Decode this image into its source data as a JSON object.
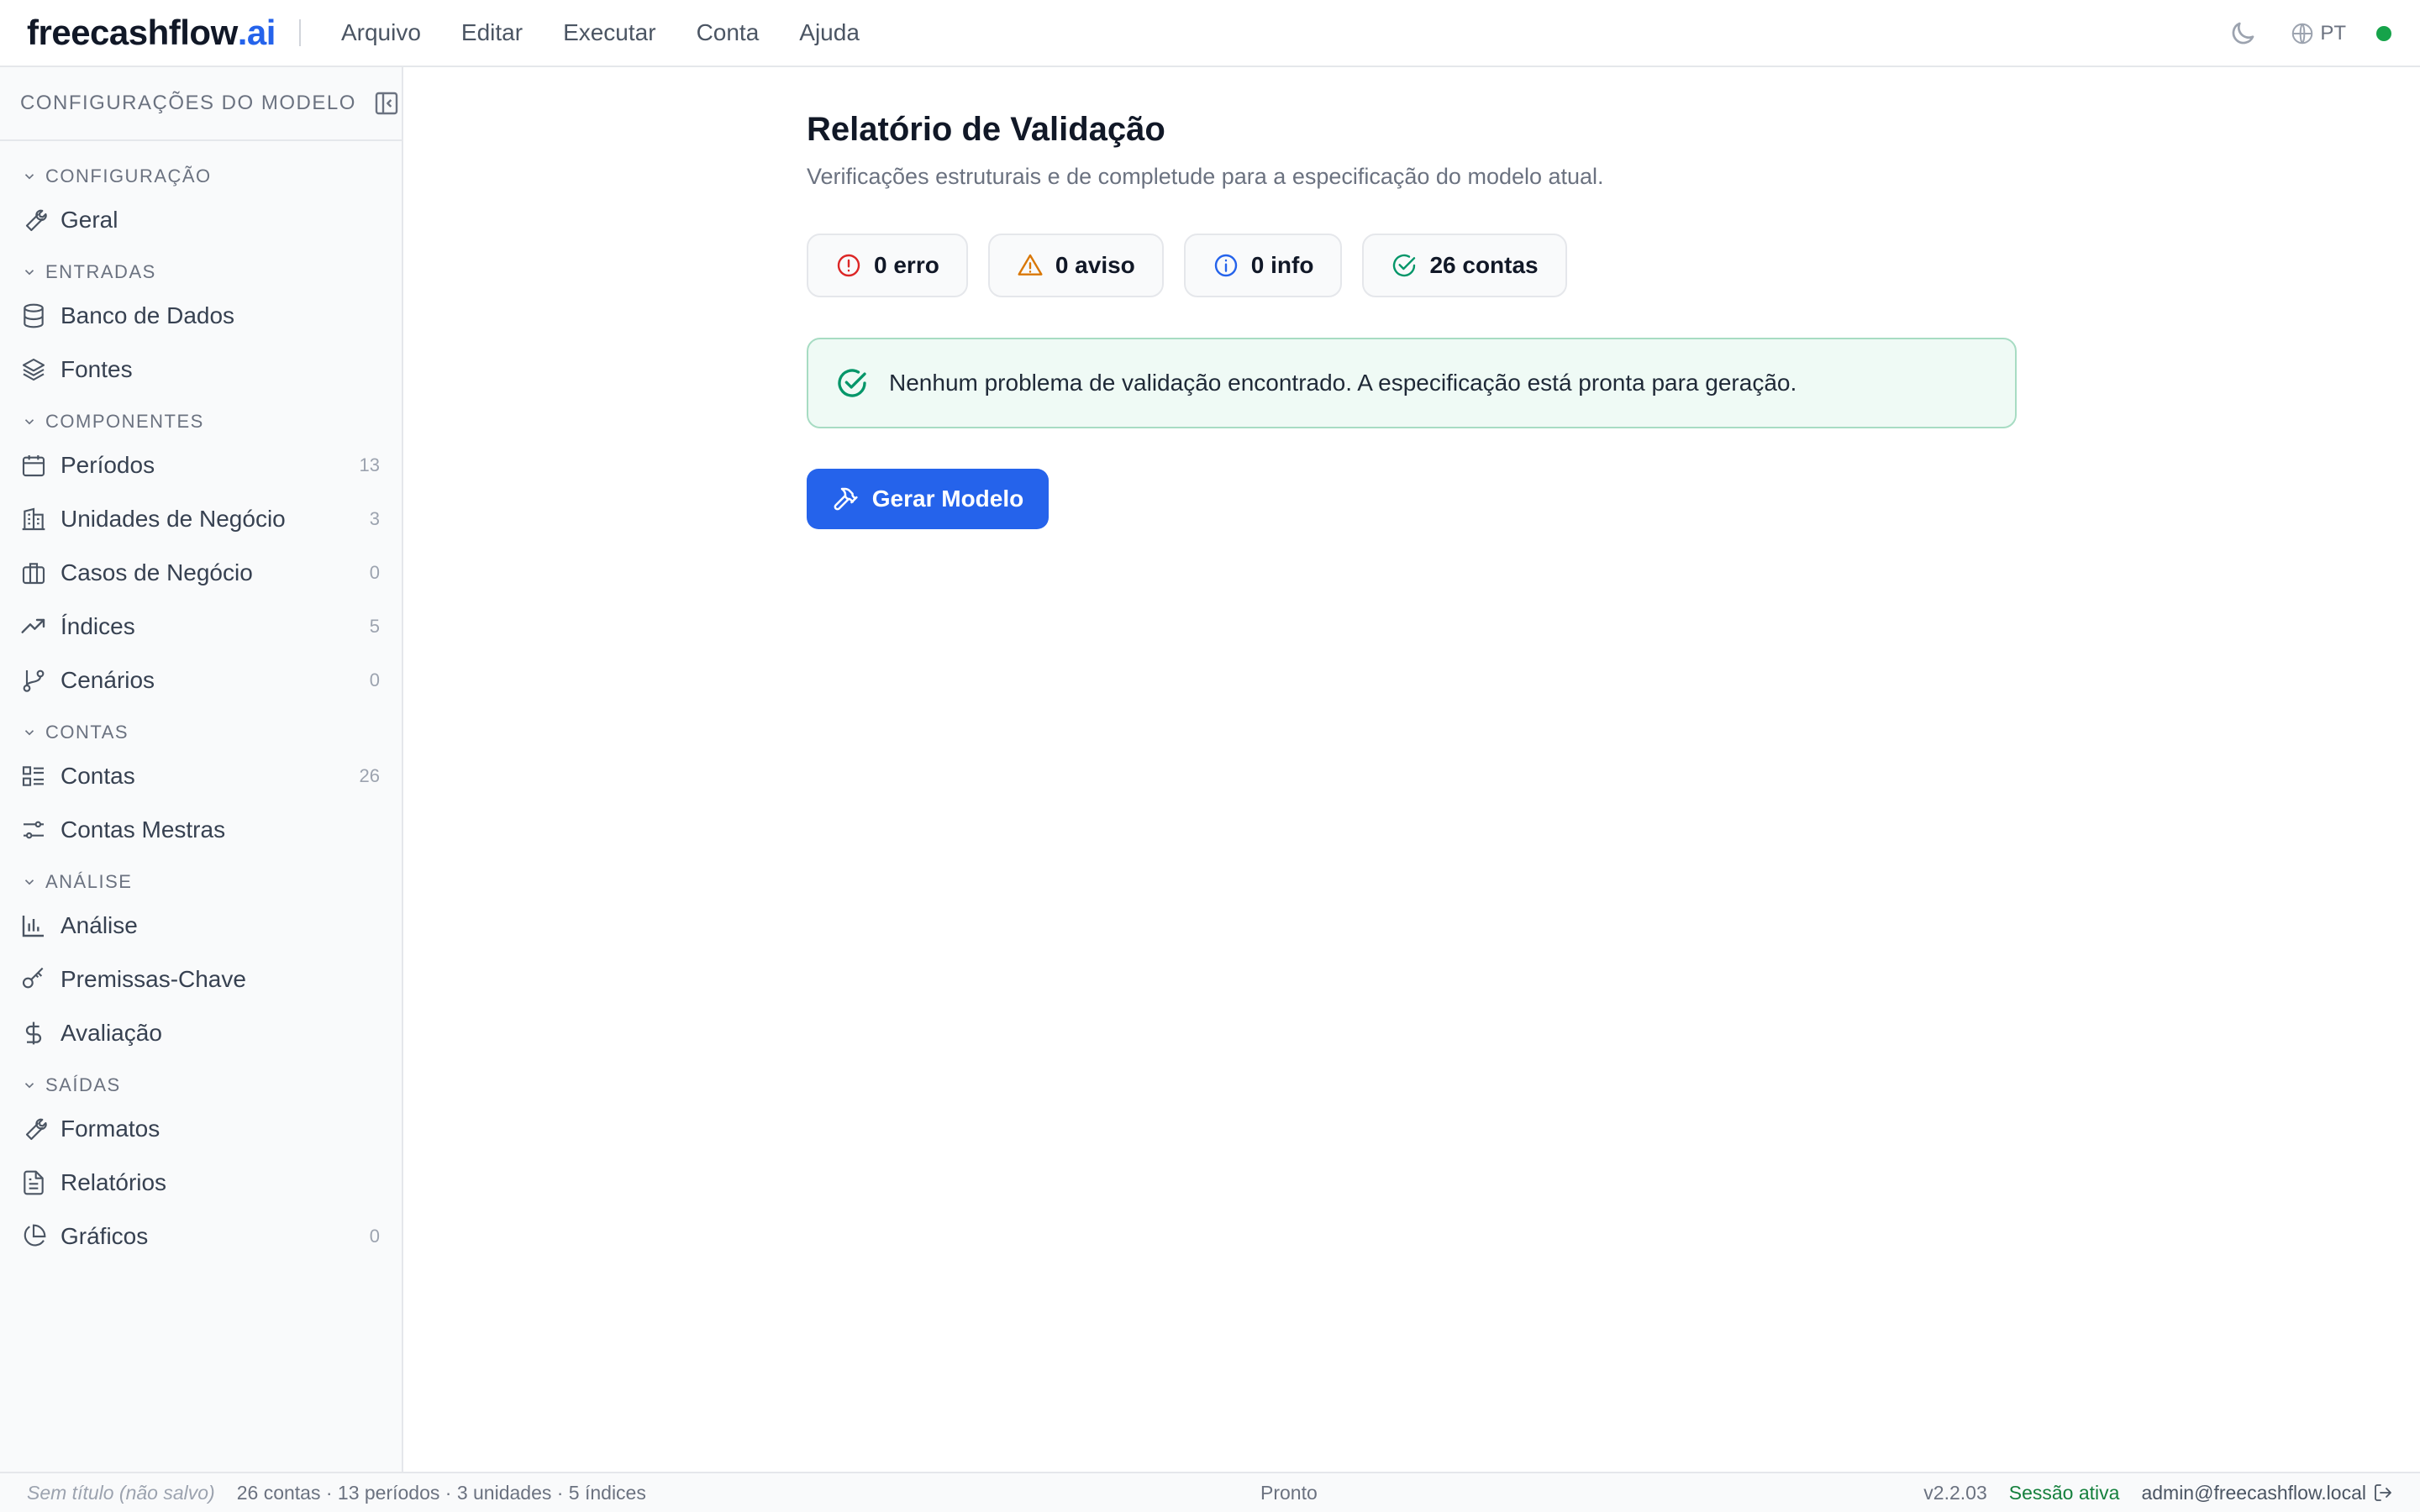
{
  "brand": {
    "name": "freecashflow",
    "suffix": ".ai"
  },
  "menu": [
    "Arquivo",
    "Editar",
    "Executar",
    "Conta",
    "Ajuda"
  ],
  "topbar": {
    "theme_icon": "moon-icon",
    "language": "PT",
    "status_color": "#16a34a"
  },
  "sidebar": {
    "title": "CONFIGURAÇÕES DO MODELO",
    "sections": [
      {
        "label": "CONFIGURAÇÃO",
        "items": [
          {
            "label": "Geral",
            "icon": "wrench-icon",
            "count": ""
          }
        ]
      },
      {
        "label": "ENTRADAS",
        "items": [
          {
            "label": "Banco de Dados",
            "icon": "database-icon",
            "count": ""
          },
          {
            "label": "Fontes",
            "icon": "layers-icon",
            "count": ""
          }
        ]
      },
      {
        "label": "COMPONENTES",
        "items": [
          {
            "label": "Períodos",
            "icon": "calendar-icon",
            "count": "13"
          },
          {
            "label": "Unidades de Negócio",
            "icon": "building-icon",
            "count": "3"
          },
          {
            "label": "Casos de Negócio",
            "icon": "briefcase-icon",
            "count": "0"
          },
          {
            "label": "Índices",
            "icon": "trending-up-icon",
            "count": "5"
          },
          {
            "label": "Cenários",
            "icon": "git-branch-icon",
            "count": "0"
          }
        ]
      },
      {
        "label": "CONTAS",
        "items": [
          {
            "label": "Contas",
            "icon": "list-icon",
            "count": "26"
          },
          {
            "label": "Contas Mestras",
            "icon": "sliders-icon",
            "count": ""
          }
        ]
      },
      {
        "label": "ANÁLISE",
        "items": [
          {
            "label": "Análise",
            "icon": "bar-chart-icon",
            "count": ""
          },
          {
            "label": "Premissas-Chave",
            "icon": "key-icon",
            "count": ""
          },
          {
            "label": "Avaliação",
            "icon": "dollar-icon",
            "count": ""
          }
        ]
      },
      {
        "label": "SAÍDAS",
        "items": [
          {
            "label": "Formatos",
            "icon": "wrench-icon",
            "count": ""
          },
          {
            "label": "Relatórios",
            "icon": "file-text-icon",
            "count": ""
          },
          {
            "label": "Gráficos",
            "icon": "pie-chart-icon",
            "count": "0"
          }
        ]
      }
    ]
  },
  "main": {
    "title": "Relatório de Validação",
    "subtitle": "Verificações estruturais e de completude para a especificação do modelo atual.",
    "summary": {
      "errors": "0 erro",
      "warnings": "0 aviso",
      "info": "0 info",
      "accounts": "26 contas"
    },
    "success_message": "Nenhum problema de validação encontrado. A especificação está pronta para geração.",
    "generate_button": "Gerar Modelo"
  },
  "statusbar": {
    "file": "Sem título (não salvo)",
    "stats": "26 contas · 13 períodos · 3 unidades · 5 índices",
    "state": "Pronto",
    "version": "v2.2.03",
    "session": "Sessão ativa",
    "user": "admin@freecashflow.local"
  },
  "colors": {
    "accent": "#2563eb",
    "error": "#dc2626",
    "warning": "#d97706",
    "info": "#2563eb",
    "success": "#059669"
  }
}
